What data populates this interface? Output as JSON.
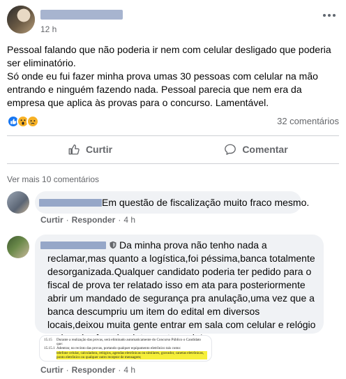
{
  "post": {
    "time": "12 h",
    "paragraphs": [
      "Pessoal falando que não poderia ir nem com celular desligado que poderia ser eliminatório.",
      "Só onde eu fui fazer minha prova umas 30 pessoas com celular na mão entrando e ninguém fazendo nada. Pessoal parecia que nem era da empresa que aplica às provas para o concurso. Lamentável."
    ],
    "reactions": [
      "like-icon",
      "wow-icon",
      "sad-icon"
    ],
    "comments_count": "32 comentários"
  },
  "actions": {
    "like_label": "Curtir",
    "comment_label": "Comentar"
  },
  "view_more": "Ver mais 10 comentários",
  "comments": [
    {
      "text": "Em questão de fiscalização muito fraco mesmo.",
      "like_label": "Curtir",
      "reply_label": "Responder",
      "separator": "·",
      "time": "4 h"
    },
    {
      "text": "Da minha prova não tenho nada a reclamar,mas quanto a logística,foi péssima,banca totalmente desorganizada.Qualquer candidato poderia ter pedido para o fiscal de prova ter relatado isso em ata para posteriormente abrir um mandado de segurança pra anulação,uma vez que a banca descumpriu um item do edital em diversos locais,deixou muita gente entrar em sala com celular e relógio e ninguém fez absolutamente nada!",
      "like_label": "Curtir",
      "reply_label": "Responder",
      "separator": "·",
      "time": "4 h",
      "attachment": {
        "lines": [
          {
            "num": "15.15",
            "text": "Durante a realização das provas, será eliminado automaticamente do Concurso Público o Candidato que:"
          },
          {
            "num": "15.15.1",
            "text": "Adentrar, no recinto das provas, portando qualquer equipamento eletrônico tais como:"
          },
          {
            "num": "",
            "text": "telefone celular, calculadora, relógios, agendas eletrônicas ou similares, gravador, canetas eletrônicas, ponto eletrônico ou qualquer outro receptor de mensagem;"
          }
        ]
      }
    }
  ],
  "colors": {
    "accent": "#1877f2",
    "muted": "#65676b",
    "bubble": "#f0f2f5"
  }
}
